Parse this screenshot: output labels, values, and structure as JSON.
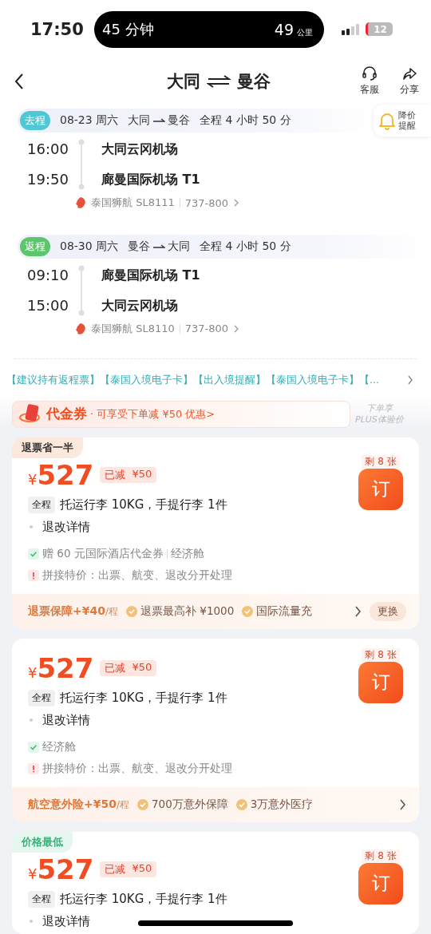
{
  "status_bar": {
    "time": "17:50",
    "island_left": "45 分钟",
    "island_value": "49",
    "island_unit": "公里",
    "battery": "12"
  },
  "header": {
    "from": "大同",
    "to": "曼谷",
    "actions": [
      {
        "kind": "headset",
        "label": "客服"
      },
      {
        "kind": "share",
        "label": "分享"
      }
    ]
  },
  "segments": [
    {
      "tag": "去程",
      "color": "#4fc8d3",
      "date": "08-23 周六",
      "from": "大同",
      "to": "曼谷",
      "duration": "全程 4 小时 50 分",
      "dep_time": "16:00",
      "dep_airport": "大同云冈机场",
      "arr_time": "19:50",
      "arr_airport": "廊曼国际机场 T1",
      "airline": "泰国狮航 SL8111",
      "aircraft": "737-800",
      "price_alert": "降价提醒"
    },
    {
      "tag": "返程",
      "color": "#5dc56b",
      "date": "08-30 周六",
      "from": "曼谷",
      "to": "大同",
      "duration": "全程 4 小时 50 分",
      "dep_time": "09:10",
      "dep_airport": "廊曼国际机场 T1",
      "arr_time": "15:00",
      "arr_airport": "大同云冈机场",
      "airline": "泰国狮航 SL8110",
      "aircraft": "737-800"
    }
  ],
  "notices": "【建议持有返程票】【泰国入境电子卡】【出入境提醒】【泰国入境电子卡】【...",
  "voucher": {
    "title": "代金券",
    "text": "· 可享受下单减 ¥50 优惠>",
    "plus_line1": "下单享",
    "plus_line2": "PLUS体验价"
  },
  "fares": [
    {
      "badge": {
        "label": "退票省一半",
        "kind": "refund"
      },
      "currency": "¥",
      "price": "527",
      "discount_label": "已减",
      "discount": "¥50",
      "remaining": "剩 8 张",
      "book": "订",
      "scope": "全程",
      "baggage": "托运行李 10KG，手提行李 1件",
      "rules": "退改详情",
      "perks": [
        {
          "kind": "check",
          "text": "赠 60 元国际酒店代金券",
          "extra": "经济舱"
        },
        {
          "kind": "warn",
          "text": "拼接特价：出票、航变、退改分开处理"
        }
      ],
      "addon": {
        "title": "退票保障",
        "price": "+¥40",
        "unit": "/程",
        "features": [
          "退票最高补 ¥1000",
          "国际流量充"
        ],
        "action": "更换"
      }
    },
    {
      "currency": "¥",
      "price": "527",
      "discount_label": "已减",
      "discount": "¥50",
      "remaining": "剩 8 张",
      "book": "订",
      "scope": "全程",
      "baggage": "托运行李 10KG，手提行李 1件",
      "rules": "退改详情",
      "perks": [
        {
          "kind": "check",
          "text": "经济舱"
        },
        {
          "kind": "warn",
          "text": "拼接特价：出票、航变、退改分开处理"
        }
      ],
      "addon": {
        "title": "航空意外险",
        "price": "+¥50",
        "unit": "/程",
        "features": [
          "700万意外保障",
          "3万意外医疗"
        ]
      }
    },
    {
      "badge": {
        "label": "价格最低",
        "kind": "lowest"
      },
      "currency": "¥",
      "price": "527",
      "discount_label": "已减",
      "discount": "¥50",
      "remaining": "剩 8 张",
      "book": "订",
      "scope": "全程",
      "baggage": "托运行李 10KG，手提行李 1件",
      "rules": "退改详情"
    }
  ]
}
